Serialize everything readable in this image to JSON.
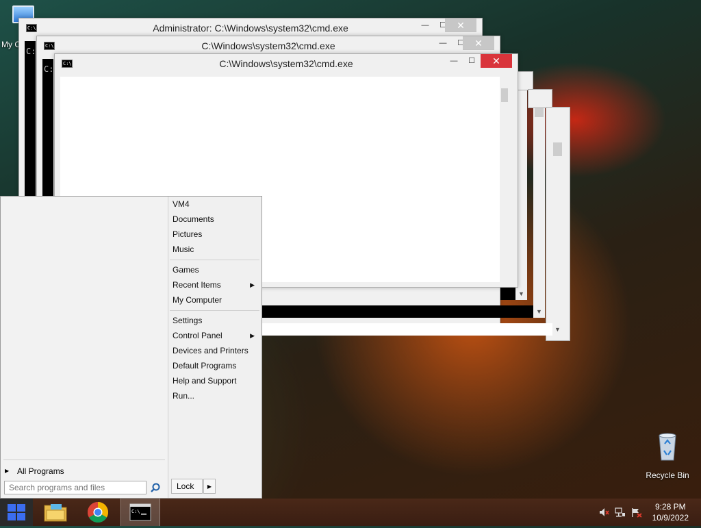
{
  "desktop": {
    "my_computer_label": "My C",
    "recycle_bin_label": "Recycle Bin"
  },
  "windows": [
    {
      "title": "Administrator: C:\\Windows\\system32\\cmd.exe",
      "prompt": "C:"
    },
    {
      "title": "C:\\Windows\\system32\\cmd.exe",
      "prompt": "C:"
    },
    {
      "title": "C:\\Windows\\system32\\cmd.exe",
      "prompt": ""
    }
  ],
  "window_controls": {
    "minimize": "—",
    "maximize": "☐",
    "close": "✕"
  },
  "start_menu": {
    "right_items": [
      "VM4",
      "Documents",
      "Pictures",
      "Music",
      "Games",
      "Recent Items",
      "My Computer",
      "Settings",
      "Control Panel",
      "Devices and Printers",
      "Default Programs",
      "Help and Support",
      "Run..."
    ],
    "all_programs": "All Programs",
    "search_placeholder": "Search programs and files",
    "lock_label": "Lock"
  },
  "taskbar": {
    "time": "9:28 PM",
    "date": "10/9/2022"
  },
  "colors": {
    "close_active": "#d9343b",
    "taskbar": "#3a1e12",
    "start_blue": "#3b6df0"
  }
}
